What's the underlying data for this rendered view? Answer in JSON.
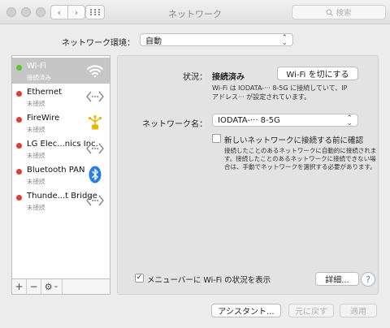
{
  "window": {
    "title": "ネットワーク",
    "search_placeholder": "検索",
    "back": "‹",
    "forward": "›"
  },
  "location": {
    "label": "ネットワーク環境：",
    "value": "自動"
  },
  "services": [
    {
      "name": "Wi-Fi",
      "status": "接続済み",
      "dot": "#5cc43a",
      "icon": "wifi-icon",
      "selected": true
    },
    {
      "name": "Ethernet",
      "status": "未接続",
      "dot": "#e03b3b",
      "icon": "ethernet-icon",
      "selected": false
    },
    {
      "name": "FireWire",
      "status": "未接続",
      "dot": "#e03b3b",
      "icon": "firewire-icon",
      "selected": false
    },
    {
      "name": "LG Elec...nics Inc.",
      "status": "未接続",
      "dot": "#e03b3b",
      "icon": "ethernet-icon",
      "selected": false
    },
    {
      "name": "Bluetooth PAN",
      "status": "未接続",
      "dot": "#e03b3b",
      "icon": "bluetooth-icon",
      "selected": false
    },
    {
      "name": "Thunde...t Bridge",
      "status": "未接続",
      "dot": "#e03b3b",
      "icon": "ethernet-icon",
      "selected": false
    }
  ],
  "toolbar": {
    "add": "+",
    "remove": "−",
    "gear": "⚙",
    "gear_chevron": "⌄"
  },
  "detail": {
    "status_label": "状況：",
    "status_value": "接続済み",
    "wifi_off_button": "Wi-Fi を切にする",
    "status_desc_line1": "Wi-Fi は IODATA-··· 8-5G に接続していて、IP",
    "status_desc_line2": "アドレス··· が設定されています。",
    "network_name_label": "ネットワーク名：",
    "network_name_value": "IODATA-··· 8-5G",
    "ask_join_label": "新しいネットワークに接続する前に確認",
    "ask_join_desc_line1": "接続したことのあるネットワークに自動的に接続されま",
    "ask_join_desc_line2": "す。接続したことのあるネットワークに接続できない場",
    "ask_join_desc_line3": "合は、手動でネットワークを選択する必要があります。",
    "show_in_menubar_label": "メニューバーに Wi-Fi の状況を表示",
    "details_button": "詳細...",
    "help": "?"
  },
  "footer": {
    "assistant": "アシスタント...",
    "revert": "元に戻す",
    "apply": "適用"
  },
  "colors": {
    "accent": "#3a7fd6",
    "connected": "#5cc43a",
    "disconnected": "#e03b3b",
    "bluetooth": "#2a7de1",
    "firewire": "#e8b700"
  }
}
